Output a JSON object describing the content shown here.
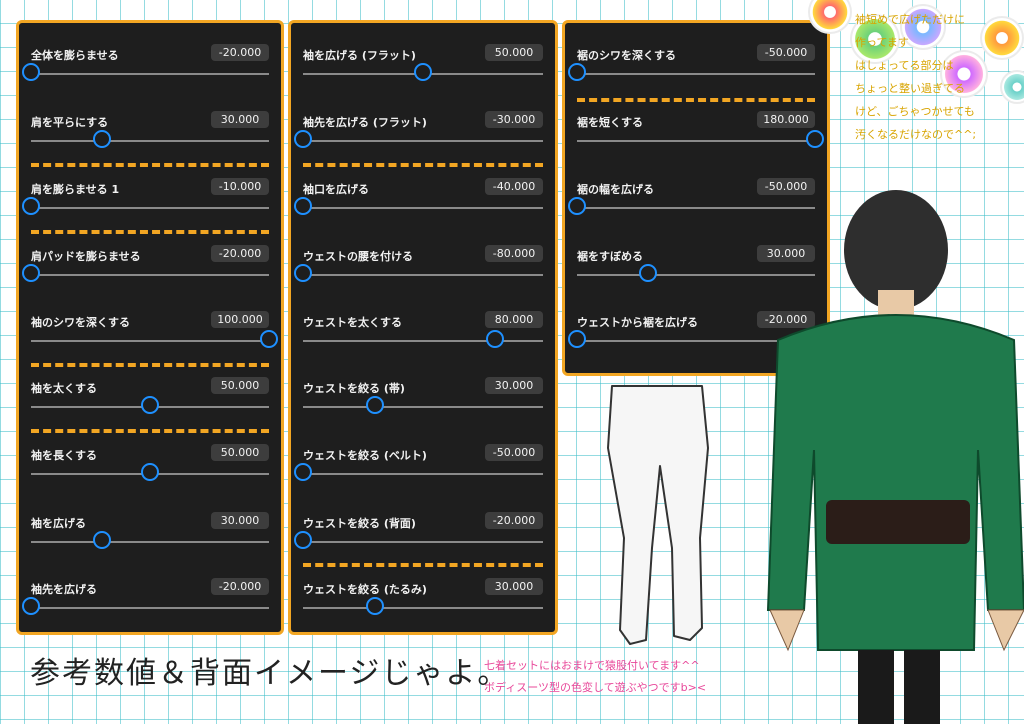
{
  "panels": [
    {
      "sliders": [
        {
          "label": "全体を膨らませる",
          "value": "-20.000",
          "pos": 0.0
        },
        {
          "label": "肩を平らにする",
          "value": "30.000",
          "pos": 0.3
        },
        {
          "label": "肩を膨らませる 1",
          "value": "-10.000",
          "pos": 0.0
        },
        {
          "label": "肩パッドを膨らませる",
          "value": "-20.000",
          "pos": 0.0
        },
        {
          "label": "袖のシワを深くする",
          "value": "100.000",
          "pos": 1.0
        },
        {
          "label": "袖を太くする",
          "value": "50.000",
          "pos": 0.5
        },
        {
          "label": "袖を長くする",
          "value": "50.000",
          "pos": 0.5
        },
        {
          "label": "袖を広げる",
          "value": "30.000",
          "pos": 0.3
        },
        {
          "label": "袖先を広げる",
          "value": "-20.000",
          "pos": 0.0
        }
      ]
    },
    {
      "sliders": [
        {
          "label": "袖を広げる (フラット)",
          "value": "50.000",
          "pos": 0.5
        },
        {
          "label": "袖先を広げる (フラット)",
          "value": "-30.000",
          "pos": 0.0
        },
        {
          "label": "袖口を広げる",
          "value": "-40.000",
          "pos": 0.0
        },
        {
          "label": "ウェストの腰を付ける",
          "value": "-80.000",
          "pos": 0.0
        },
        {
          "label": "ウェストを太くする",
          "value": "80.000",
          "pos": 0.8
        },
        {
          "label": "ウェストを絞る (帯)",
          "value": "30.000",
          "pos": 0.3
        },
        {
          "label": "ウェストを絞る (ベルト)",
          "value": "-50.000",
          "pos": 0.0
        },
        {
          "label": "ウェストを絞る (背面)",
          "value": "-20.000",
          "pos": 0.0
        },
        {
          "label": "ウェストを絞る (たるみ)",
          "value": "30.000",
          "pos": 0.3
        }
      ]
    },
    {
      "sliders": [
        {
          "label": "裾のシワを深くする",
          "value": "-50.000",
          "pos": 0.0
        },
        {
          "label": "裾を短くする",
          "value": "180.000",
          "pos": 1.0
        },
        {
          "label": "裾の幅を広げる",
          "value": "-50.000",
          "pos": 0.0
        },
        {
          "label": "裾をすぼめる",
          "value": "30.000",
          "pos": 0.3
        },
        {
          "label": "ウェストから裾を広げる",
          "value": "-20.000",
          "pos": 0.0
        }
      ]
    }
  ],
  "caption": "参考数値＆背面イメージじゃよ。",
  "note_pink": [
    "七着セットにはおまけで猿股付いてます^^",
    "ボディスーツ型の色変して遊ぶやつですb><"
  ],
  "note_yellow": [
    "袖短めで広げただけに",
    "作ってます",
    "はしょってる部分は",
    "ちょっと整い過ぎてる",
    "けど、ごちゃつかせても",
    "汚くなるだけなので^^;"
  ],
  "colors": {
    "accent": "#f2a623",
    "panel_bg": "#1e1e1e",
    "thumb": "#1e90ff",
    "grid": "#3cbec8",
    "coat": "#1f7a4c"
  }
}
